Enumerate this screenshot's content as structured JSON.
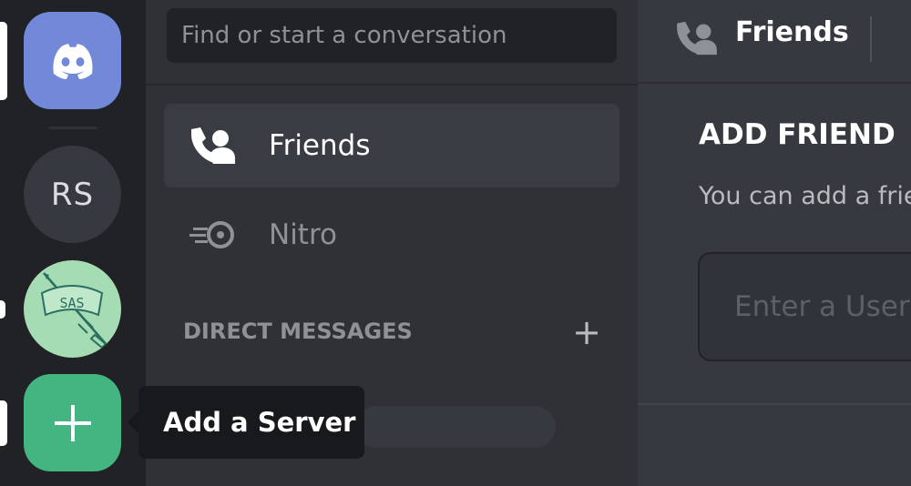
{
  "search": {
    "placeholder": "Find or start a conversation"
  },
  "servers": {
    "home_icon": "discord-logo-icon",
    "rs_label": "RS",
    "sas_label": "SAS",
    "add_icon": "plus-icon"
  },
  "tooltip": {
    "text": "Add a Server"
  },
  "nav": {
    "friends_label": "Friends",
    "nitro_label": "Nitro"
  },
  "direct_messages": {
    "header": "DIRECT MESSAGES",
    "add_symbol": "+"
  },
  "topbar": {
    "title": "Friends"
  },
  "add_friend": {
    "heading": "ADD FRIEND",
    "description": "You can add a frie",
    "input_placeholder": "Enter a User"
  },
  "colors": {
    "blurple": "#7289da",
    "green": "#43b581",
    "rail_bg": "#202225",
    "panel_bg": "#2f3136",
    "main_bg": "#36393f"
  }
}
